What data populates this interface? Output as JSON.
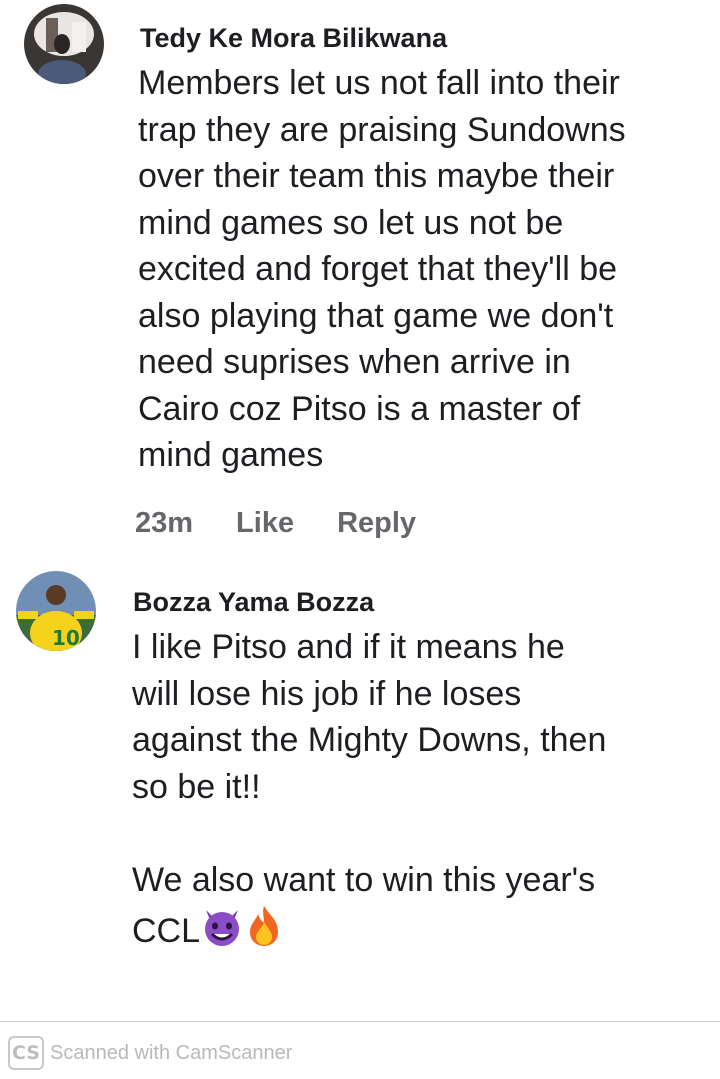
{
  "comments": [
    {
      "author": "Tedy Ke Mora Bilikwana",
      "text": "Members let us not fall into their\ntrap they are praising Sundowns\nover their team this maybe their\nmind games so let us not be\nexcited and forget that they'll be\nalso playing that game we don't\nneed suprises when arrive in\nCairo coz Pitso is a master of\nmind games",
      "time": "23m",
      "like_label": "Like",
      "reply_label": "Reply"
    },
    {
      "author": "Bozza Yama Bozza",
      "text": "I like Pitso and if it means he\nwill lose his job if he loses\nagainst the Mighty Downs, then\nso be it!!\n\nWe also want to win this year's",
      "text_last_line": "CCL",
      "emojis": [
        "smiling-imp-icon",
        "fire-icon"
      ],
      "jersey_number": "10"
    }
  ],
  "watermark": {
    "logo": "CS",
    "text": "Scanned with CamScanner"
  }
}
